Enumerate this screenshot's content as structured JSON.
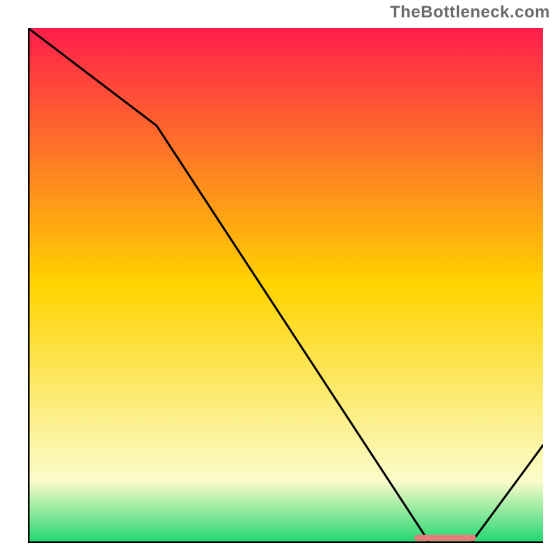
{
  "watermark": "TheBottleneck.com",
  "chart_data": {
    "type": "line",
    "title": "",
    "xlabel": "",
    "ylabel": "",
    "xlim": [
      0,
      100
    ],
    "ylim": [
      0,
      100
    ],
    "x": [
      0,
      25,
      78,
      86,
      100
    ],
    "values": [
      100,
      81,
      0,
      0,
      19
    ],
    "marker_range_x": [
      75,
      87
    ],
    "colors": {
      "gradient_top": "#ff1e4b",
      "gradient_mid": "#ffd400",
      "gradient_low": "#fbfccb",
      "gradient_bottom": "#1fd66f",
      "line": "#000000",
      "axis": "#000000",
      "marker": "#e77c7c"
    }
  }
}
